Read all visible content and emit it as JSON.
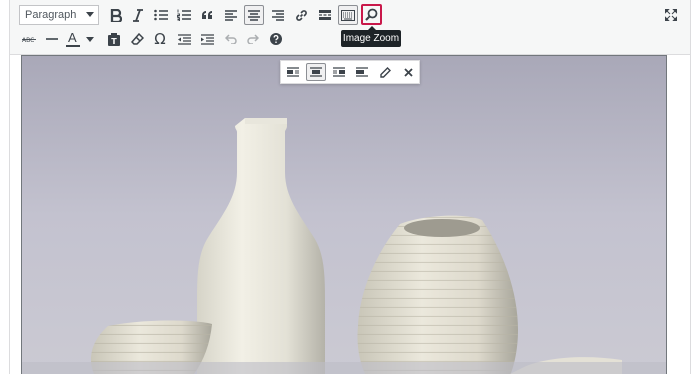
{
  "toolbar": {
    "format_value": "Paragraph",
    "tooltip": "Image Zoom",
    "text_color_letter": "A",
    "omega": "Ω",
    "row1_icons": [
      "bold-icon",
      "italic-icon",
      "bullet-list-icon",
      "numbered-list-icon",
      "blockquote-icon",
      "align-left-icon",
      "align-center-icon",
      "align-right-icon",
      "link-icon",
      "read-more-icon",
      "toolbar-toggle-icon",
      "image-zoom-icon",
      "fullscreen-icon"
    ],
    "row2_icons": [
      "strikethrough-icon",
      "horizontal-line-icon",
      "text-color-icon",
      "paste-as-text-icon",
      "clear-formatting-icon",
      "special-character-icon",
      "decrease-indent-icon",
      "increase-indent-icon",
      "undo-icon",
      "redo-icon",
      "help-icon"
    ]
  },
  "image_toolbar": {
    "icons": [
      "image-align-left-icon",
      "image-align-center-icon",
      "image-align-right-icon",
      "image-align-none-icon",
      "edit-image-icon",
      "remove-image-icon"
    ]
  },
  "image": {
    "subject": "vases-photo"
  },
  "colors": {
    "accent_highlight": "#c9184a",
    "toolbar_bg": "#f6f7f7",
    "icon": "#3c434a",
    "tooltip_bg": "#1d2327"
  }
}
